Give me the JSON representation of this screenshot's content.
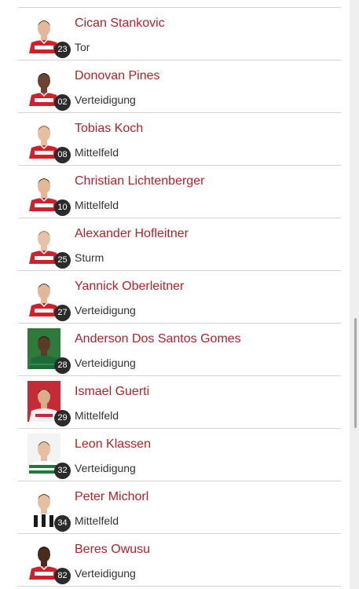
{
  "players": [
    {
      "name": "Cican Stankovic",
      "number": "23",
      "position": "Tor",
      "kit": "red",
      "skin": "#e2b898",
      "hair": "#3a2a1e"
    },
    {
      "name": "Donovan Pines",
      "number": "02",
      "position": "Verteidigung",
      "kit": "red",
      "skin": "#6b4330",
      "hair": "#1e1410"
    },
    {
      "name": "Tobias Koch",
      "number": "08",
      "position": "Mittelfeld",
      "kit": "red",
      "skin": "#e6bea0",
      "hair": "#6b4a2c"
    },
    {
      "name": "Christian Lichtenberger",
      "number": "10",
      "position": "Mittelfeld",
      "kit": "red",
      "skin": "#e2b898",
      "hair": "#2a1e16"
    },
    {
      "name": "Alexander Hofleitner",
      "number": "25",
      "position": "Sturm",
      "kit": "red",
      "skin": "#e8c2a6",
      "hair": "#8a6a44"
    },
    {
      "name": "Yannick Oberleitner",
      "number": "27",
      "position": "Verteidigung",
      "kit": "red",
      "skin": "#e2b898",
      "hair": "#3a2a1e"
    },
    {
      "name": "Anderson Dos Santos Gomes",
      "number": "28",
      "position": "Verteidigung",
      "kit": "green",
      "skin": "#5c3a28",
      "hair": "#1a120c"
    },
    {
      "name": "Ismael Guerti",
      "number": "29",
      "position": "Mittelfeld",
      "kit": "redwhite",
      "skin": "#d9ad8a",
      "hair": "#1e1410"
    },
    {
      "name": "Leon Klassen",
      "number": "32",
      "position": "Verteidigung",
      "kit": "greenhoops",
      "skin": "#e6bea0",
      "hair": "#5a3e26"
    },
    {
      "name": "Peter Michorl",
      "number": "34",
      "position": "Mittelfeld",
      "kit": "blackwhite",
      "skin": "#e6bea0",
      "hair": "#3a2a1e"
    },
    {
      "name": "Beres Owusu",
      "number": "82",
      "position": "Verteidigung",
      "kit": "red",
      "skin": "#4a2c1e",
      "hair": "#140e0a"
    }
  ],
  "colors": {
    "name_text": "#b5202a",
    "position_text": "#333333",
    "number_badge": "#2b2b2b",
    "divider": "#d4d4d4"
  }
}
